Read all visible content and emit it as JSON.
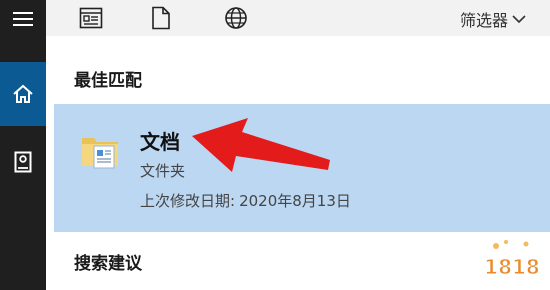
{
  "filters": {
    "label": "筛选器",
    "icon": "chevron-down-icon"
  },
  "rail": {
    "items": [
      {
        "name": "hamburger-menu",
        "icon": "hamburger-icon"
      },
      {
        "name": "home",
        "icon": "home-icon",
        "active": true
      },
      {
        "name": "notebook",
        "icon": "notebook-icon"
      }
    ]
  },
  "top_icons": [
    {
      "name": "apps-filter",
      "icon": "app-window-icon"
    },
    {
      "name": "documents-filter",
      "icon": "document-icon"
    },
    {
      "name": "web-filter",
      "icon": "globe-icon"
    }
  ],
  "best_match": {
    "title": "最佳匹配",
    "result": {
      "name": "文档",
      "type": "文件夹",
      "date_label": "上次修改日期:",
      "date_value": "2020年8月13日",
      "icon": "folder-icon"
    }
  },
  "suggestions": {
    "title": "搜索建议"
  },
  "colors": {
    "rail_bg": "#1f1f1f",
    "rail_active": "#0b5a94",
    "selection_bg": "#bcd7f1",
    "arrow": "#e31b1b"
  },
  "watermark": {
    "text": "1818"
  }
}
